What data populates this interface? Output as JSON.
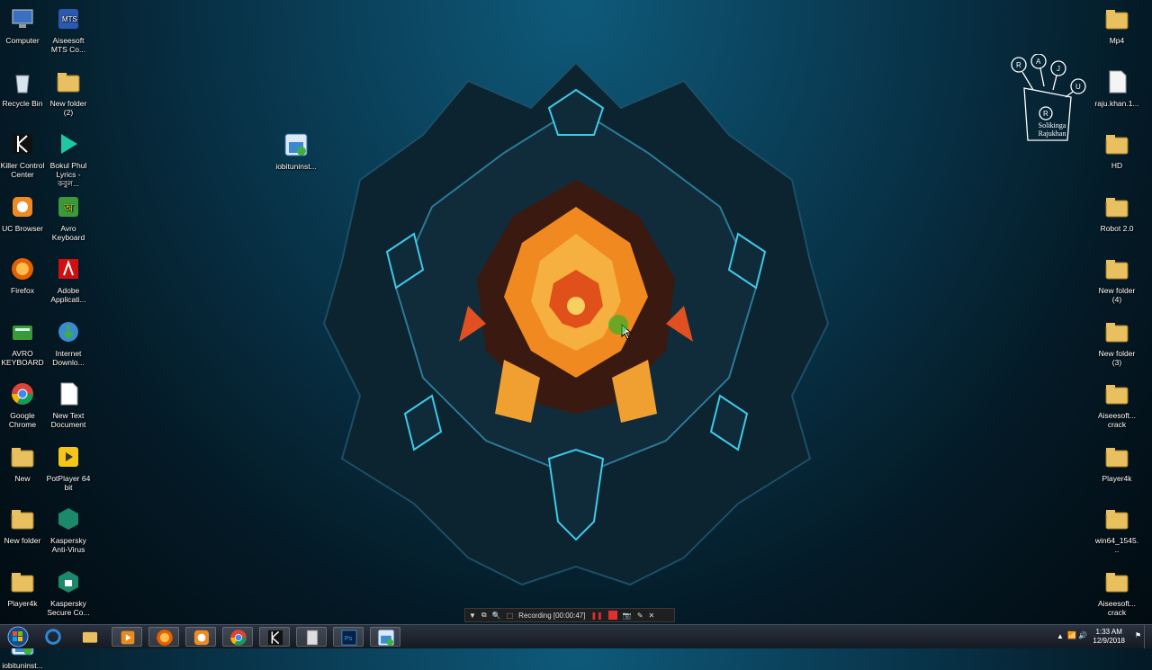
{
  "desktop_icons_left": [
    {
      "name": "Computer",
      "icon": "computer-icon"
    },
    {
      "name": "Aiseesoft MTS Co...",
      "icon": "mts-converter-icon"
    },
    {
      "name": "Recycle Bin",
      "icon": "recycle-bin-icon"
    },
    {
      "name": "New folder (2)",
      "icon": "folder-icon"
    },
    {
      "name": "Killer Control Center",
      "icon": "killer-icon"
    },
    {
      "name": "Bokul Phul Lyrics - কবুল...",
      "icon": "mp3-icon"
    },
    {
      "name": "UC Browser",
      "icon": "uc-browser-icon"
    },
    {
      "name": "Avro Keyboard",
      "icon": "avro-icon"
    },
    {
      "name": "Firefox",
      "icon": "firefox-icon"
    },
    {
      "name": "Adobe Applicati...",
      "icon": "adobe-icon"
    },
    {
      "name": "AVRO KEYBOARD",
      "icon": "avro-keyboard-icon"
    },
    {
      "name": "Internet Downlo...",
      "icon": "idm-icon"
    },
    {
      "name": "Google Chrome",
      "icon": "chrome-icon"
    },
    {
      "name": "New Text Document",
      "icon": "text-document-icon"
    },
    {
      "name": "New",
      "icon": "folder-icon"
    },
    {
      "name": "PotPlayer 64 bit",
      "icon": "potplayer-icon"
    },
    {
      "name": "New folder",
      "icon": "folder-icon"
    },
    {
      "name": "Kaspersky Anti-Virus",
      "icon": "kaspersky-icon"
    },
    {
      "name": "Player4k",
      "icon": "folder-icon"
    },
    {
      "name": "Kaspersky Secure Co...",
      "icon": "kaspersky-secure-icon"
    },
    {
      "name": "iobituninst...",
      "icon": "iobit-icon"
    }
  ],
  "desktop_icon_center": {
    "name": "iobituninst...",
    "icon": "iobit-icon"
  },
  "desktop_icons_right": [
    {
      "name": "Mp4",
      "icon": "folder-icon"
    },
    {
      "name": "raju.khan.1...",
      "icon": "file-icon"
    },
    {
      "name": "HD",
      "icon": "folder-icon"
    },
    {
      "name": "Robot 2.0",
      "icon": "folder-icon"
    },
    {
      "name": "New folder (4)",
      "icon": "folder-icon"
    },
    {
      "name": "New folder (3)",
      "icon": "folder-icon"
    },
    {
      "name": "Aiseesoft... crack",
      "icon": "folder-icon"
    },
    {
      "name": "Player4k",
      "icon": "folder-icon"
    },
    {
      "name": "win64_1545...",
      "icon": "folder-icon"
    },
    {
      "name": "Aiseesoft... crack",
      "icon": "folder-icon"
    }
  ],
  "logo": {
    "letters": [
      "R",
      "A",
      "J",
      "U"
    ],
    "center": "R",
    "caption": "Solikinga Rajukhan"
  },
  "recording_bar": {
    "label": "Recording [00:00:47]"
  },
  "taskbar": {
    "buttons": [
      {
        "name": "ie",
        "icon": "internet-explorer-icon"
      },
      {
        "name": "explorer",
        "icon": "file-explorer-icon"
      },
      {
        "name": "media",
        "icon": "media-player-icon"
      },
      {
        "name": "firefox",
        "icon": "firefox-icon"
      },
      {
        "name": "uc",
        "icon": "uc-browser-icon"
      },
      {
        "name": "chrome",
        "icon": "chrome-icon"
      },
      {
        "name": "killer",
        "icon": "killer-icon"
      },
      {
        "name": "calc",
        "icon": "calculator-icon"
      },
      {
        "name": "photoshop",
        "icon": "photoshop-icon"
      },
      {
        "name": "iobit",
        "icon": "iobit-icon"
      }
    ],
    "time": "1:33 AM",
    "date": "12/9/2018"
  },
  "colors": {
    "taskbar": "#141a22",
    "accent_orange": "#f08a20",
    "accent_cyan": "#3fc9e8"
  }
}
